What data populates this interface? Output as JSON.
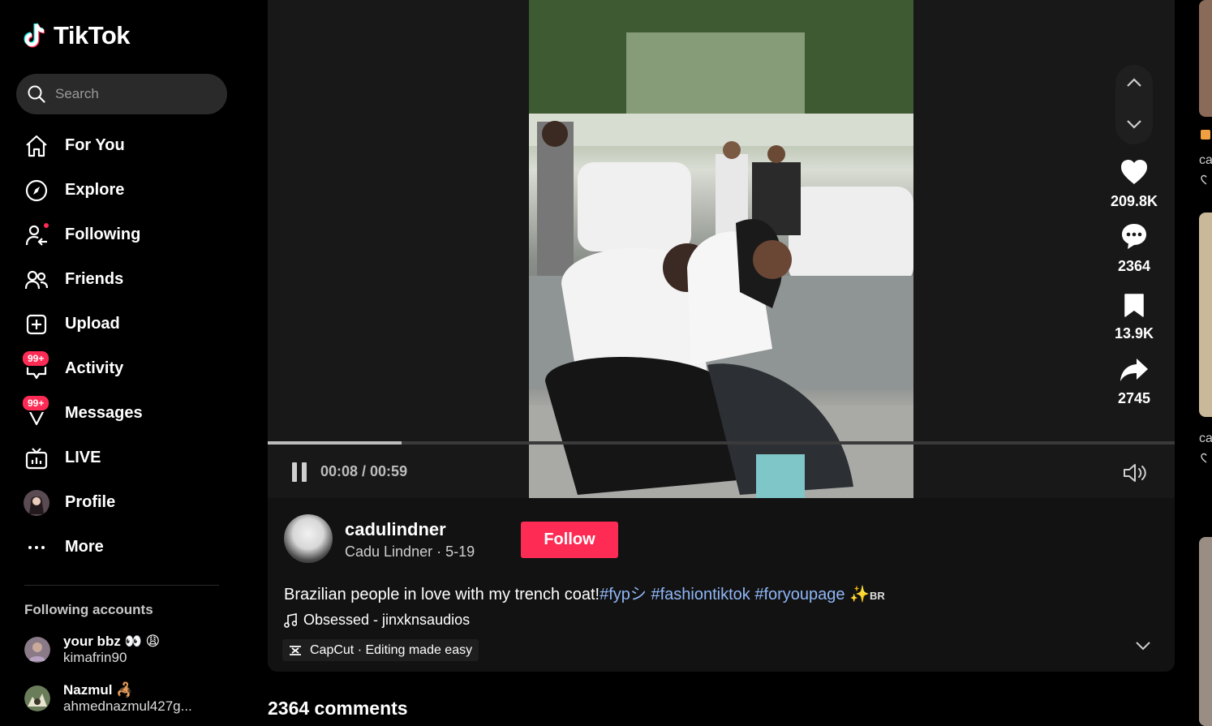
{
  "app": {
    "name": "TikTok"
  },
  "search": {
    "placeholder": "Search"
  },
  "nav": [
    {
      "label": "For You",
      "icon": "home-icon"
    },
    {
      "label": "Explore",
      "icon": "compass-icon"
    },
    {
      "label": "Following",
      "icon": "following-icon"
    },
    {
      "label": "Friends",
      "icon": "friends-icon"
    },
    {
      "label": "Upload",
      "icon": "upload-icon"
    },
    {
      "label": "Activity",
      "icon": "activity-icon",
      "badge": "99+"
    },
    {
      "label": "Messages",
      "icon": "messages-icon",
      "badge": "99+"
    },
    {
      "label": "LIVE",
      "icon": "live-icon"
    },
    {
      "label": "Profile",
      "icon": "profile-avatar"
    },
    {
      "label": "More",
      "icon": "more-icon"
    }
  ],
  "following_accounts": {
    "title": "Following accounts",
    "items": [
      {
        "name": "your bbz 👀 😩",
        "handle": "kimafrin90"
      },
      {
        "name": "Nazmul 🦂",
        "handle": "ahmednazmul427g..."
      }
    ]
  },
  "player": {
    "time": "00:08 / 00:59",
    "progress_fraction": 0.148
  },
  "actions": {
    "likes": "209.8K",
    "comments": "2364",
    "saves": "13.9K",
    "shares": "2745"
  },
  "post": {
    "username": "cadulindner",
    "nickname": "Cadu Lindner · 5-19",
    "follow_label": "Follow",
    "desc_text": "Brazilian people in love with my trench coat!",
    "tags": [
      "#fypシ",
      "#fashiontiktok",
      "#foryoupage"
    ],
    "desc_suffix": "✨",
    "desc_flag": "BR",
    "music": "Obsessed - jinxknsaudios",
    "anchor": "CapCut · Editing made easy"
  },
  "comments_header": "2364 comments",
  "right_column": {
    "label": "ca"
  },
  "colors": {
    "accent": "#fe2c55",
    "tag": "#8fb7f7"
  }
}
